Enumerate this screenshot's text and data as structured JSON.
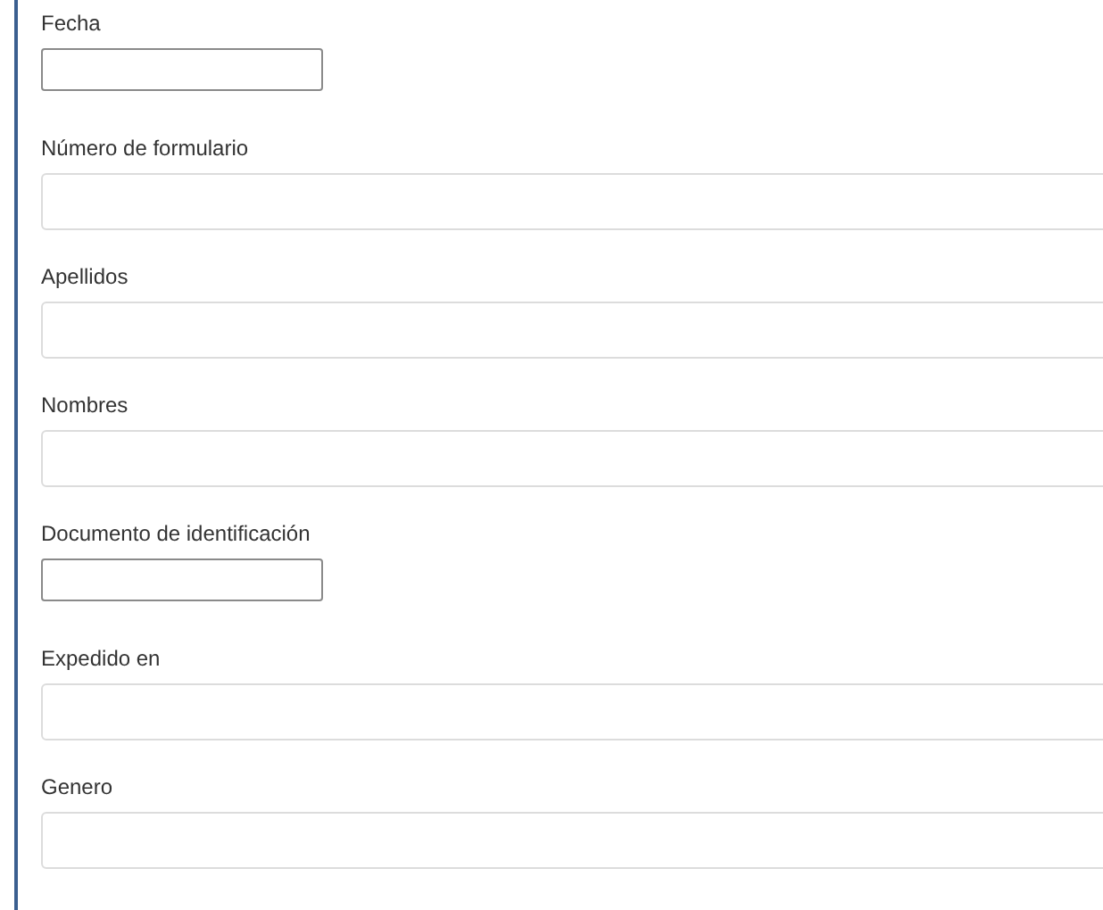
{
  "form": {
    "fields": [
      {
        "label": "Fecha",
        "kind": "short"
      },
      {
        "label": "Número de formulario",
        "kind": "wide"
      },
      {
        "label": "Apellidos",
        "kind": "wide"
      },
      {
        "label": "Nombres",
        "kind": "wide"
      },
      {
        "label": "Documento de identificación",
        "kind": "short"
      },
      {
        "label": "Expedido en",
        "kind": "wide"
      },
      {
        "label": "Genero",
        "kind": "wide"
      }
    ]
  }
}
